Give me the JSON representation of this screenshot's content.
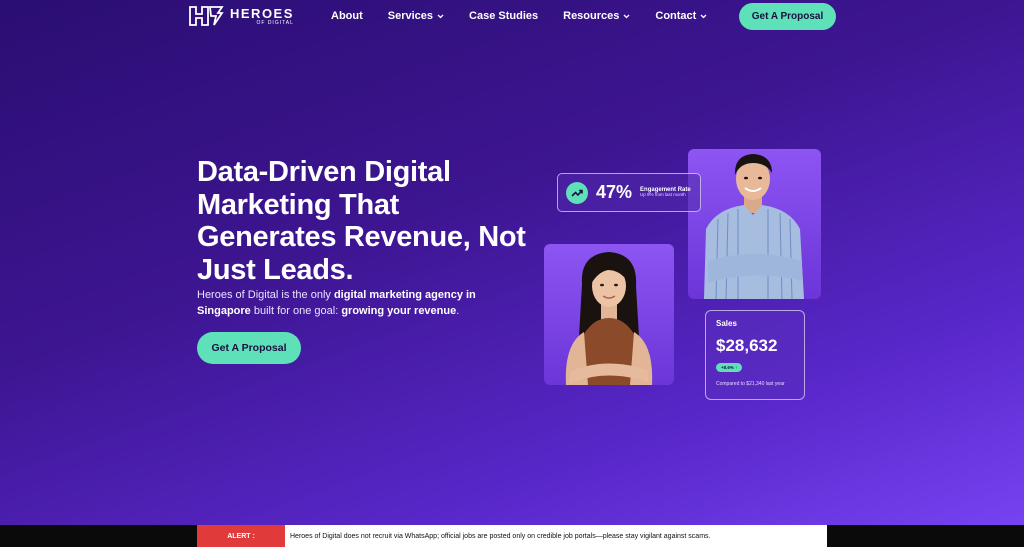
{
  "brand": {
    "name": "HEROES",
    "tagline": "OF DIGITAL",
    "accent_color": "#5ee0b8",
    "icon": "heroes-logo-icon"
  },
  "nav": {
    "items": [
      {
        "label": "About",
        "has_dropdown": false
      },
      {
        "label": "Services",
        "has_dropdown": true
      },
      {
        "label": "Case Studies",
        "has_dropdown": false
      },
      {
        "label": "Resources",
        "has_dropdown": true
      },
      {
        "label": "Contact",
        "has_dropdown": true
      }
    ],
    "cta_label": "Get A Proposal"
  },
  "hero": {
    "title": "Data-Driven Digital Marketing That Generates Revenue, Not Just Leads.",
    "desc_part1": "Heroes of Digital is the only ",
    "desc_bold1": "digital marketing agency in Singapore",
    "desc_part2": " built for one goal: ",
    "desc_bold2": "growing your revenue",
    "desc_part3": ".",
    "cta_label": "Get A Proposal"
  },
  "engagement_card": {
    "icon": "trend-up-icon",
    "value": "47%",
    "label": "Engagement Rate",
    "sub": "Up 9% from last month"
  },
  "sales_card": {
    "label": "Sales",
    "value": "$28,632",
    "badge": "+8.6% ↑",
    "compare": "Compared to $21,340 last year"
  },
  "alert": {
    "label": "ALERT :",
    "text": "Heroes of Digital does not recruit via WhatsApp; official jobs are posted only on credible job portals—please stay vigilant against scams."
  }
}
